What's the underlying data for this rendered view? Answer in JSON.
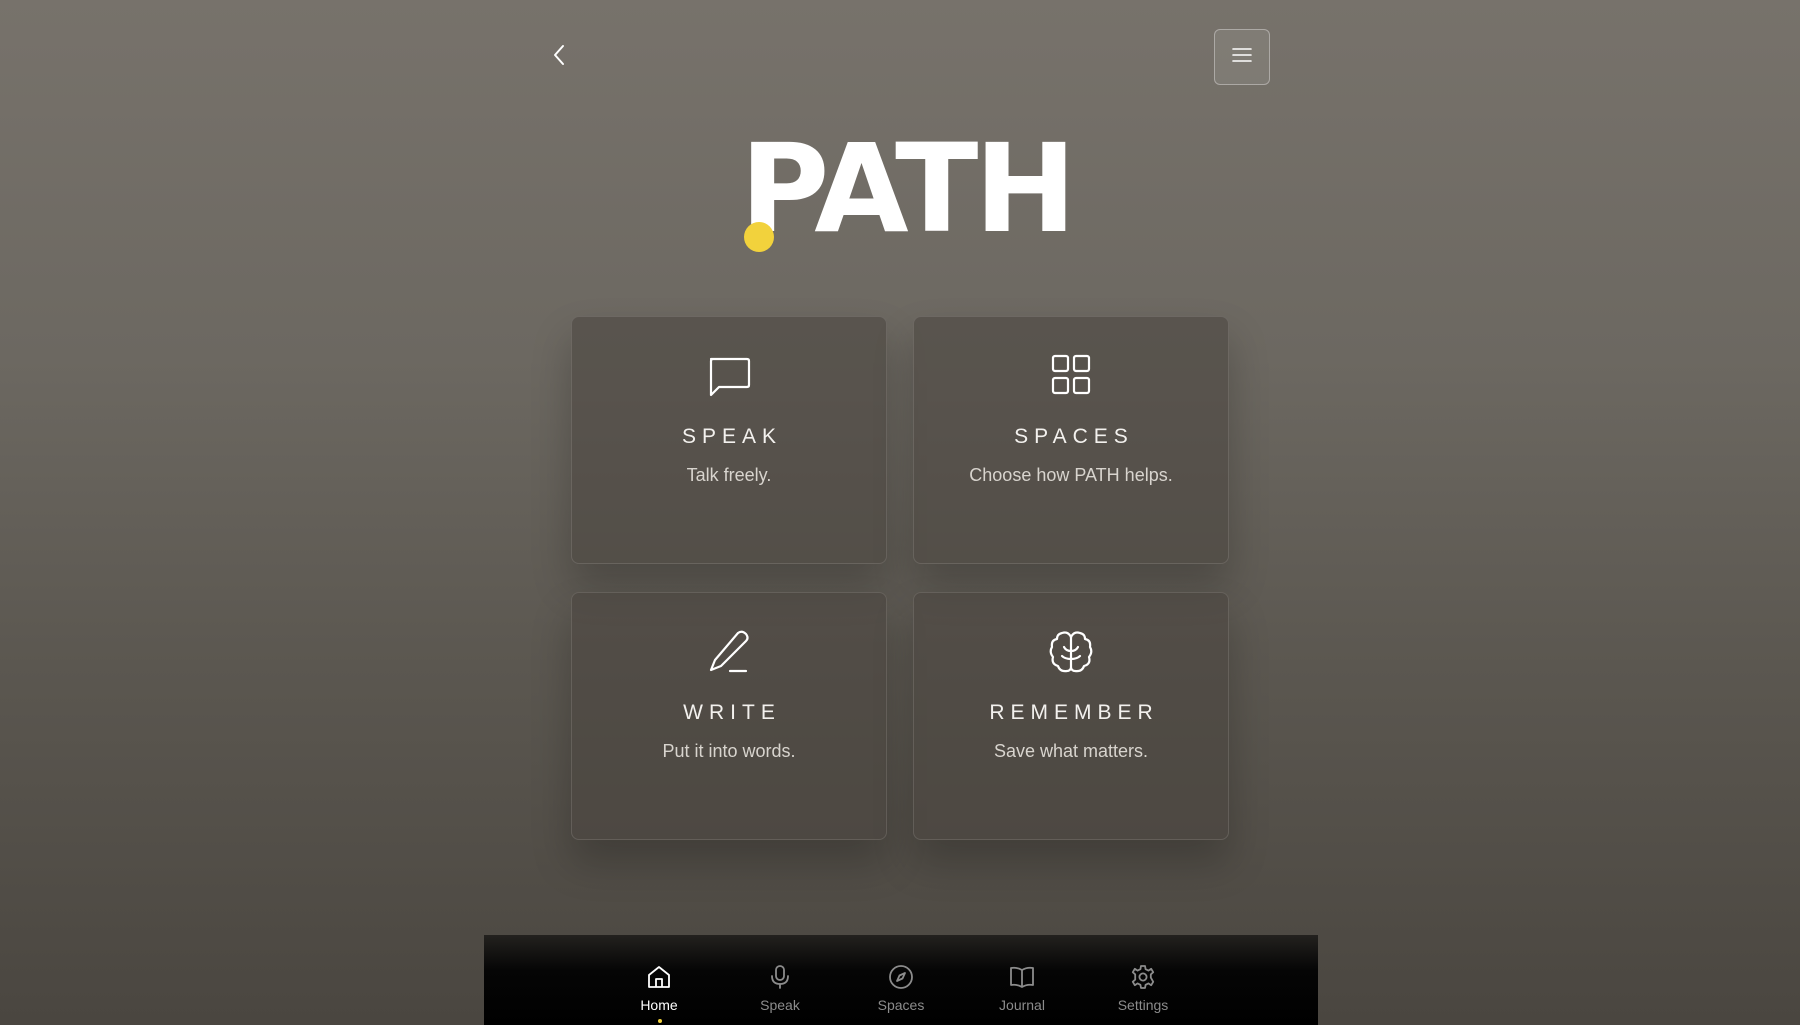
{
  "header": {
    "back_icon": "chevron-left-icon",
    "menu_icon": "hamburger-menu-icon"
  },
  "logo": {
    "text": "PATH",
    "dot_color": "#f2d23c"
  },
  "cards": [
    {
      "icon": "chat-bubble-icon",
      "title": "SPEAK",
      "description": "Talk freely."
    },
    {
      "icon": "grid-icon",
      "title": "SPACES",
      "description": "Choose how PATH helps."
    },
    {
      "icon": "pen-icon",
      "title": "WRITE",
      "description": "Put it into words."
    },
    {
      "icon": "brain-icon",
      "title": "REMEMBER",
      "description": "Save what matters."
    }
  ],
  "nav": {
    "active_index": 0,
    "accent_color": "#f2d23c",
    "items": [
      {
        "label": "Home",
        "icon": "home-icon"
      },
      {
        "label": "Speak",
        "icon": "microphone-icon"
      },
      {
        "label": "Spaces",
        "icon": "compass-icon"
      },
      {
        "label": "Journal",
        "icon": "book-icon"
      },
      {
        "label": "Settings",
        "icon": "gear-icon"
      }
    ]
  }
}
